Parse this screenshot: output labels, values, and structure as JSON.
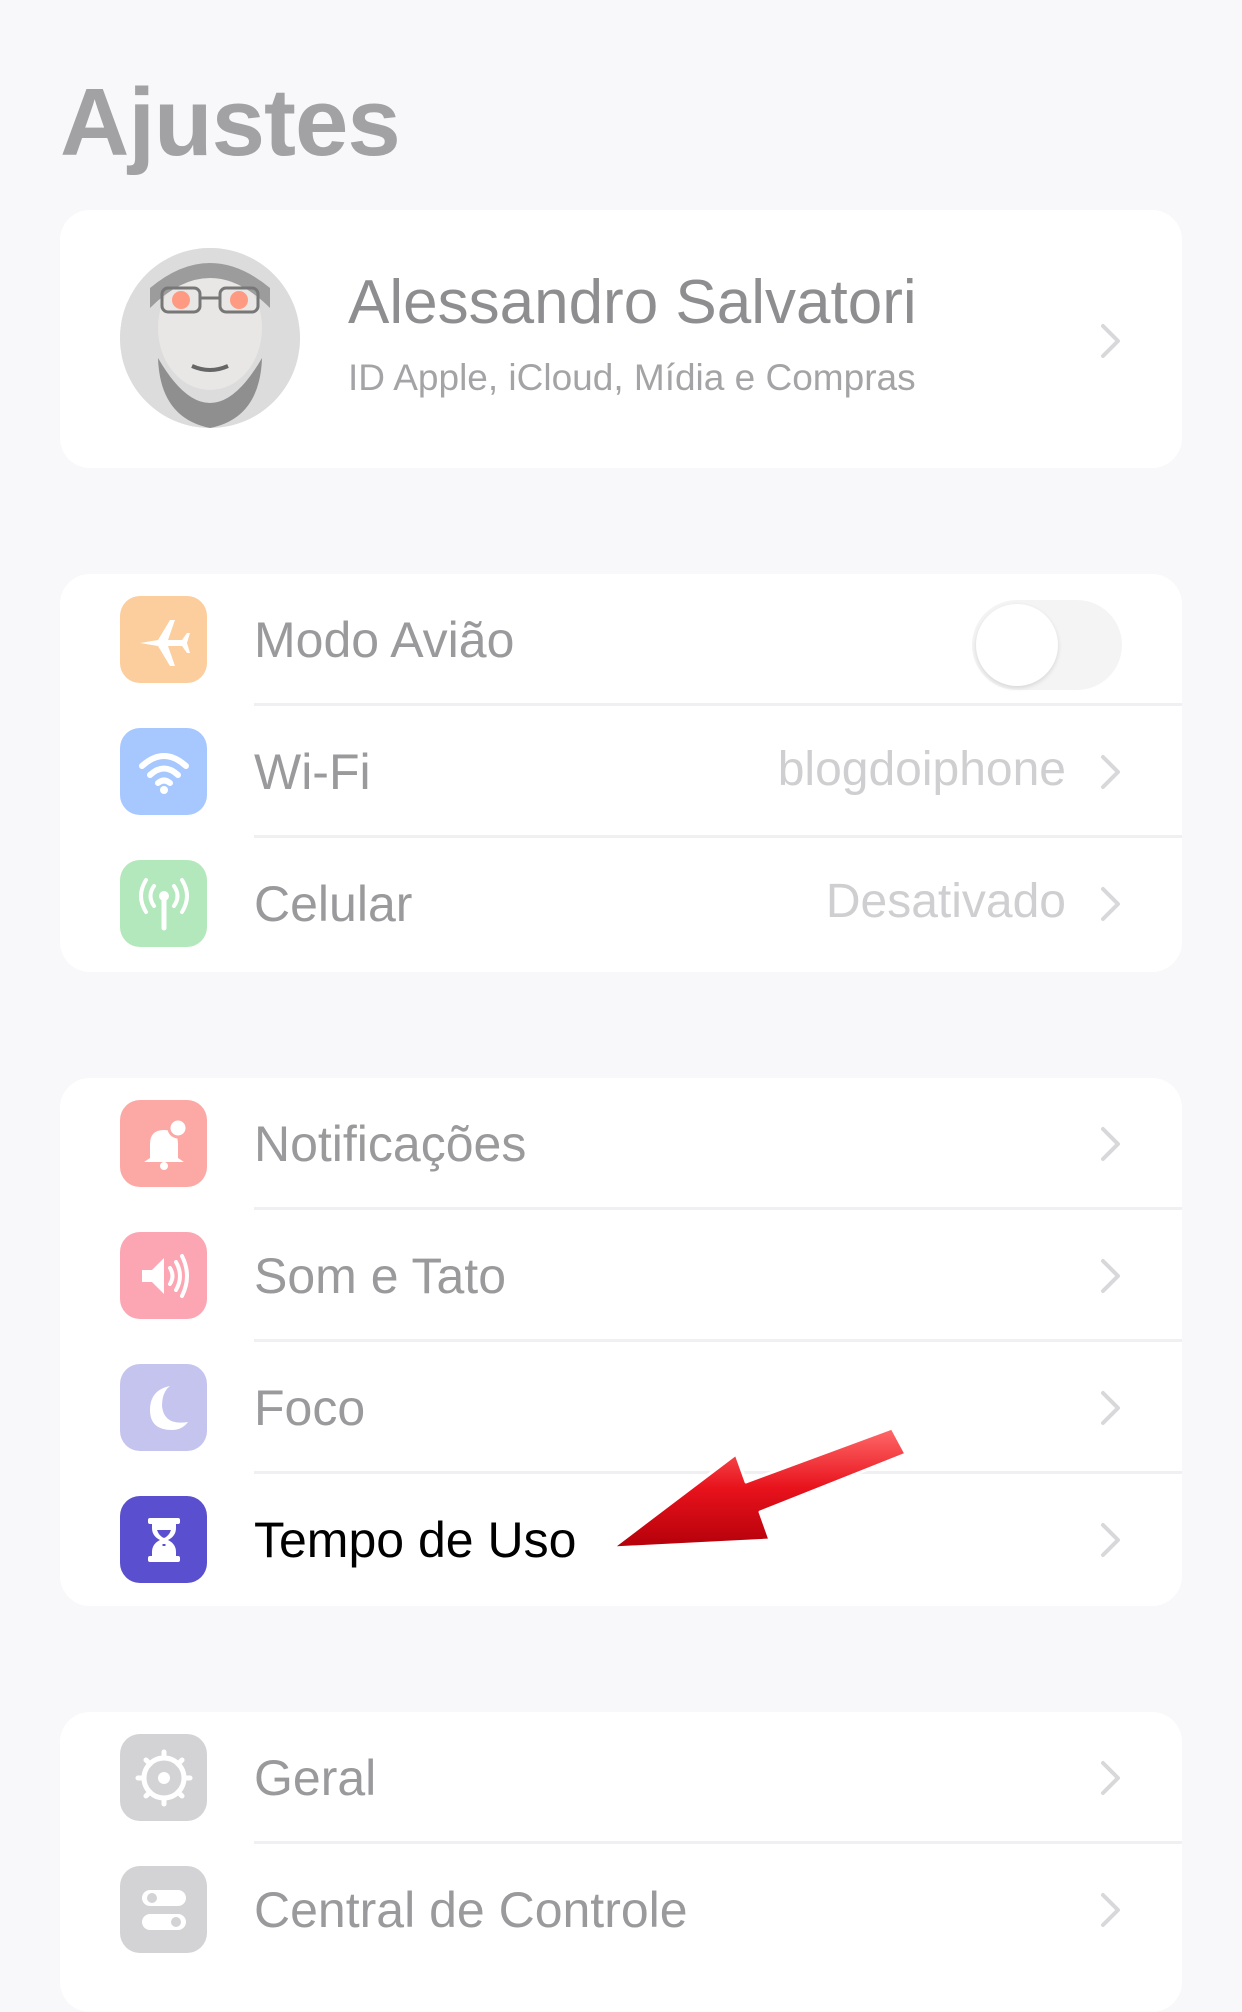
{
  "header": {
    "title": "Ajustes"
  },
  "profile": {
    "name": "Alessandro Salvatori",
    "subtitle": "ID Apple, iCloud, Mídia e Compras"
  },
  "connectivity": {
    "items": [
      {
        "label": "Modo Avião",
        "icon": "airplane-icon",
        "icon_color": "#fccd9d",
        "toggle_on": false
      },
      {
        "label": "Wi-Fi",
        "icon": "wifi-icon",
        "icon_color": "#a6c8ff",
        "value": "blogdoiphone"
      },
      {
        "label": "Celular",
        "icon": "antenna-icon",
        "icon_color": "#b3e8bc",
        "value": "Desativado"
      }
    ]
  },
  "notifications_group": {
    "items": [
      {
        "label": "Notificações",
        "icon": "bell-icon",
        "icon_color": "#fca9a6"
      },
      {
        "label": "Som e Tato",
        "icon": "speaker-icon",
        "icon_color": "#fca6b3"
      },
      {
        "label": "Foco",
        "icon": "moon-icon",
        "icon_color": "#c5c4ef"
      },
      {
        "label": "Tempo de Uso",
        "icon": "hourglass-icon",
        "icon_color": "#5a4fcf"
      }
    ]
  },
  "general_group": {
    "items": [
      {
        "label": "Geral",
        "icon": "gear-icon",
        "icon_color": "#d3d3d6"
      },
      {
        "label": "Central de Controle",
        "icon": "switches-icon",
        "icon_color": "#d3d3d6"
      }
    ]
  },
  "annotation": {
    "arrow_color": "#e8121c",
    "arrow_target": "Tempo de Uso"
  }
}
